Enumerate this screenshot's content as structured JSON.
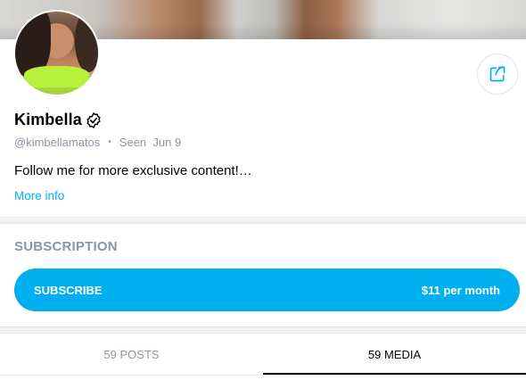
{
  "profile": {
    "name": "Kimbella",
    "username": "@kimbellamatos",
    "seen": "Seen  Jun 9",
    "bio": "Follow me for more exclusive content!…",
    "more_info": "More info"
  },
  "subscription": {
    "heading": "SUBSCRIPTION",
    "button_label": "SUBSCRIBE",
    "price": "$11 per month"
  },
  "tabs": [
    {
      "label": "59 POSTS"
    },
    {
      "label": "59 MEDIA"
    }
  ],
  "colors": {
    "accent": "#00aff0",
    "muted": "#8a96a3"
  },
  "icons": {
    "share": "share-icon",
    "verified": "verified-badge-icon"
  }
}
